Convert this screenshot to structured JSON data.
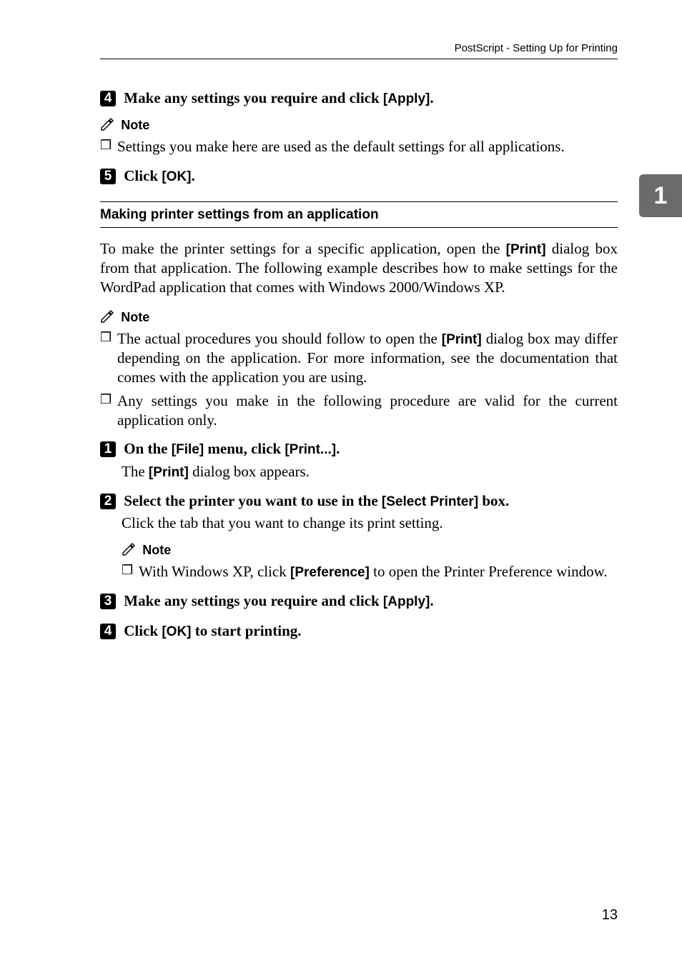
{
  "running_head": "PostScript - Setting Up for Printing",
  "side_tab": "1",
  "step4": {
    "num": "4",
    "pre": "Make any settings you require and click ",
    "ui": "[Apply]",
    "post": "."
  },
  "note_label": "Note",
  "note_after_step4": "Settings you make here are used as the default settings for all applications.",
  "step5": {
    "num": "5",
    "pre": "Click ",
    "ui": "[OK]",
    "post": "."
  },
  "section_heading": "Making printer settings from an application",
  "section_para_pre": "To make the printer settings for a specific application, open the ",
  "section_para_ui": "[Print]",
  "section_para_post": " dialog box from that application. The following example describes how to make settings for the WordPad application that comes with Windows 2000/Windows XP.",
  "note_block2": {
    "bullet1_pre": "The actual procedures you should follow to open the ",
    "bullet1_ui": "[Print]",
    "bullet1_post": " dialog box may differ depending on the application. For more information, see the documentation that comes with the application you are using.",
    "bullet2": "Any settings you make in the following procedure are valid for the current application only."
  },
  "stepA": {
    "num": "1",
    "pre": "On the ",
    "ui1": "[File]",
    "mid": " menu, click ",
    "ui2": "[Print...]",
    "post": ".",
    "result_pre": "The ",
    "result_ui": "[Print]",
    "result_post": " dialog box appears."
  },
  "stepB": {
    "num": "2",
    "pre": "Select the printer you want to use in the ",
    "ui": "[Select Printer]",
    "post": " box.",
    "result": "Click the tab that you want to change its print setting."
  },
  "note_block3": {
    "bullet_pre": "With Windows XP, click ",
    "bullet_ui": "[Preference]",
    "bullet_post": " to open the Printer Preference window."
  },
  "stepC": {
    "num": "3",
    "pre": "Make any settings you require and click ",
    "ui": "[Apply]",
    "post": "."
  },
  "stepD": {
    "num": "4",
    "pre": "Click ",
    "ui": "[OK]",
    "post": " to start printing."
  },
  "page_number": "13",
  "bullet_symbol": "❒"
}
